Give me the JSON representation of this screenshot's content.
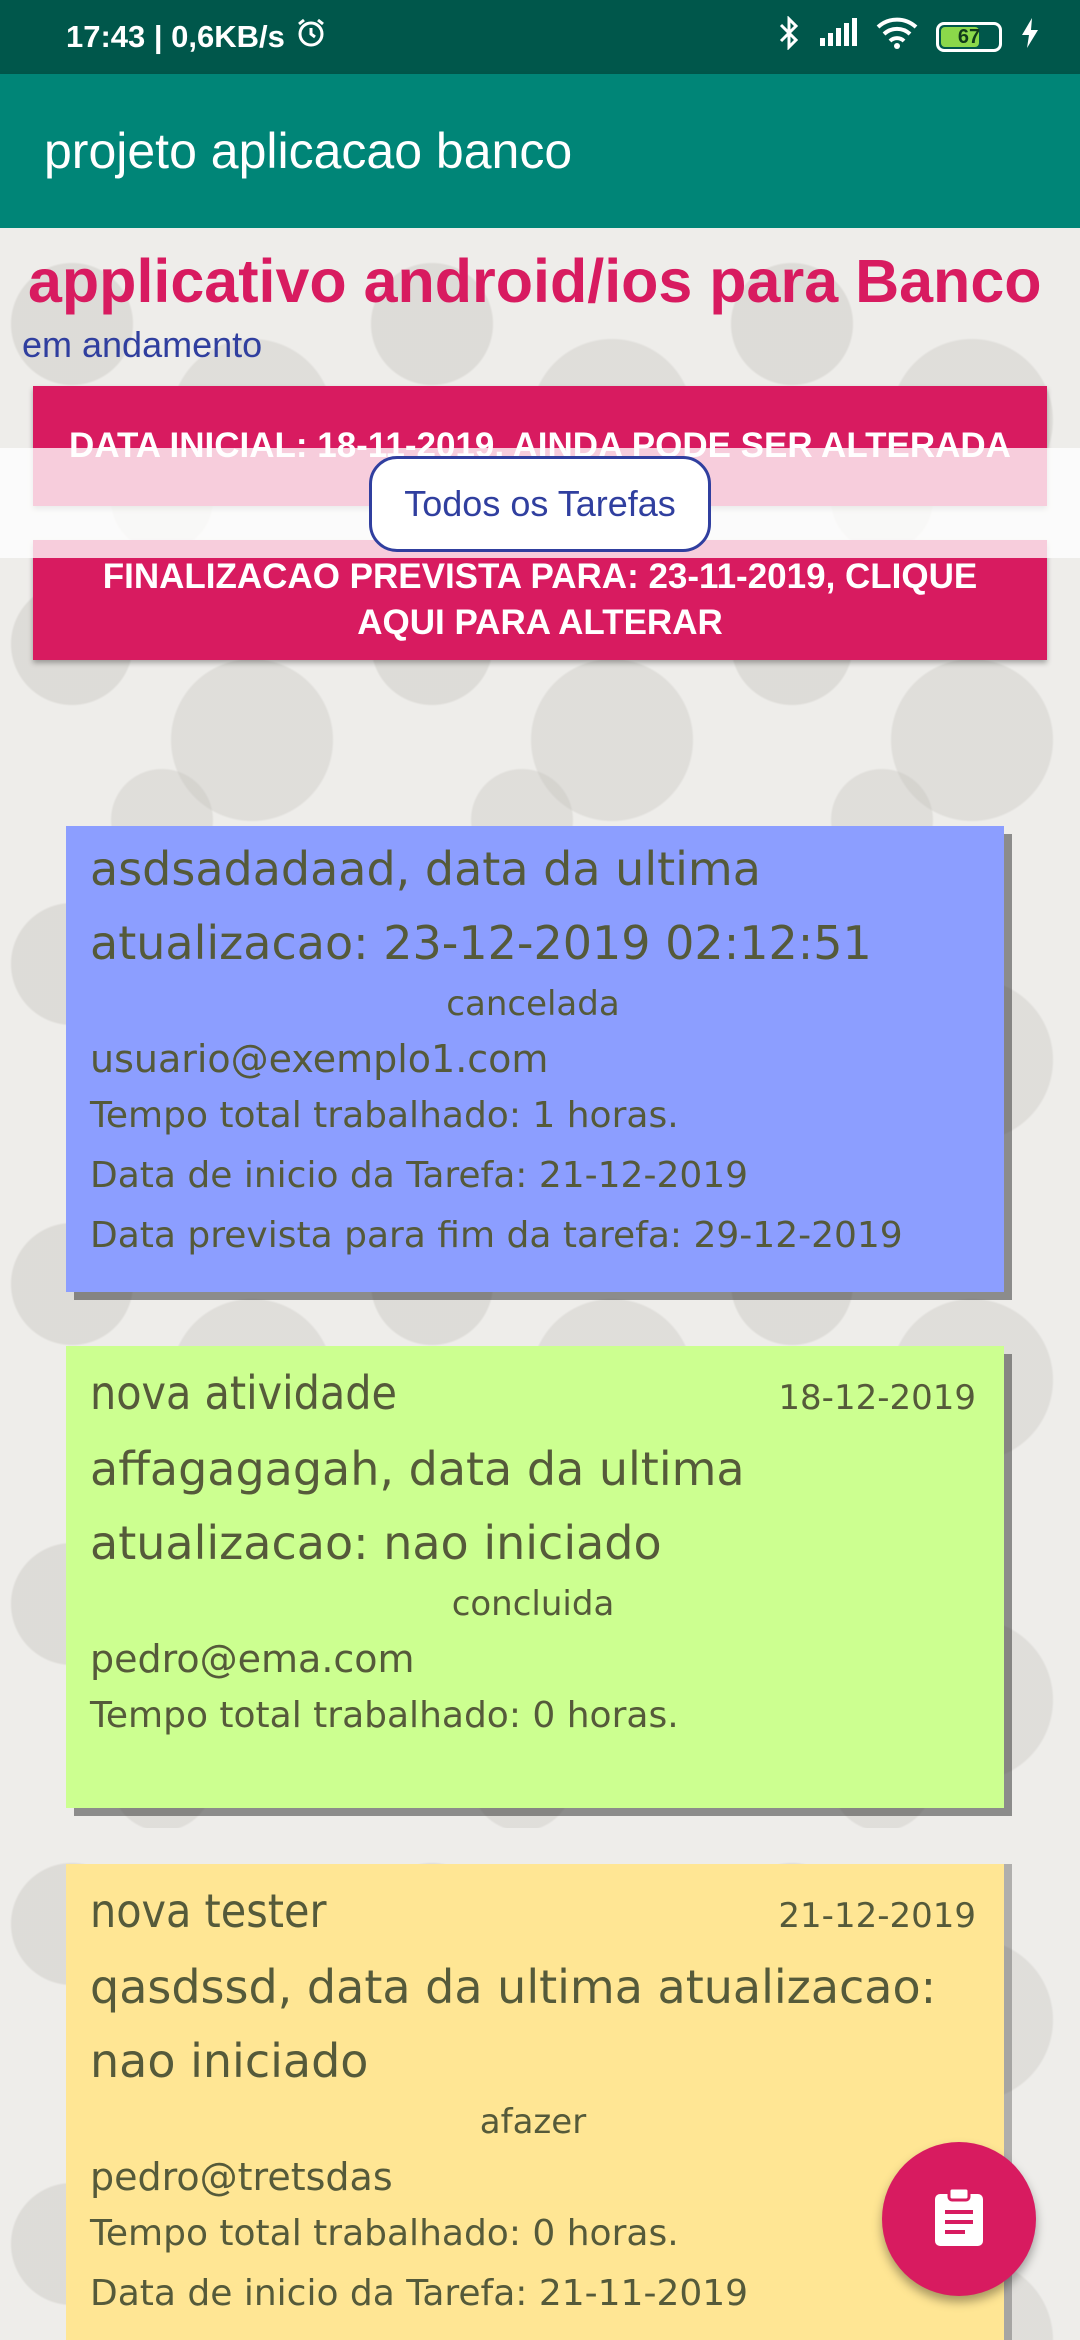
{
  "status_bar": {
    "time_speed": "17:43 | 0,6KB/s",
    "battery": "67"
  },
  "app_bar": {
    "title": "projeto aplicacao banco"
  },
  "project": {
    "title": "applicativo android/ios para Banco",
    "status": "em andamento",
    "start_button": "DATA INICIAL: 18-11-2019, AINDA PODE SER ALTERADA",
    "end_button": "FINALIZACAO PREVISTA PARA: 23-11-2019, CLIQUE AQUI PARA ALTERAR"
  },
  "filter": {
    "label": "Todos os Tarefas"
  },
  "tasks": [
    {
      "color": "#8c9eff",
      "description": "asdsadadaad, data da ultima atualizacao: 23-12-2019 02:12:51",
      "state": "cancelada",
      "user": "usuario@exemplo1.com",
      "hours": "Tempo total trabalhado: 1 horas.",
      "start": "Data de inicio da Tarefa: 21-12-2019",
      "end": "Data prevista para fim da tarefa: 29-12-2019"
    },
    {
      "color": "#ccff90",
      "name": "nova atividade",
      "date": "18-12-2019",
      "description": "affagagagah, data da ultima atualizacao: nao iniciado",
      "state": "concluida",
      "user": "pedro@ema.com",
      "hours": "Tempo total trabalhado: 0 horas."
    },
    {
      "color": "#ffe694",
      "name": "nova tester",
      "date": "21-12-2019",
      "description": "qasdssd, data da ultima atualizacao: nao iniciado",
      "state": "afazer",
      "user": "pedro@tretsdas",
      "hours": "Tempo total trabalhado: 0 horas.",
      "start": "Data de inicio da Tarefa: 21-11-2019"
    }
  ],
  "fab": {
    "icon": "clipboard-icon",
    "color": "#d81b60"
  }
}
